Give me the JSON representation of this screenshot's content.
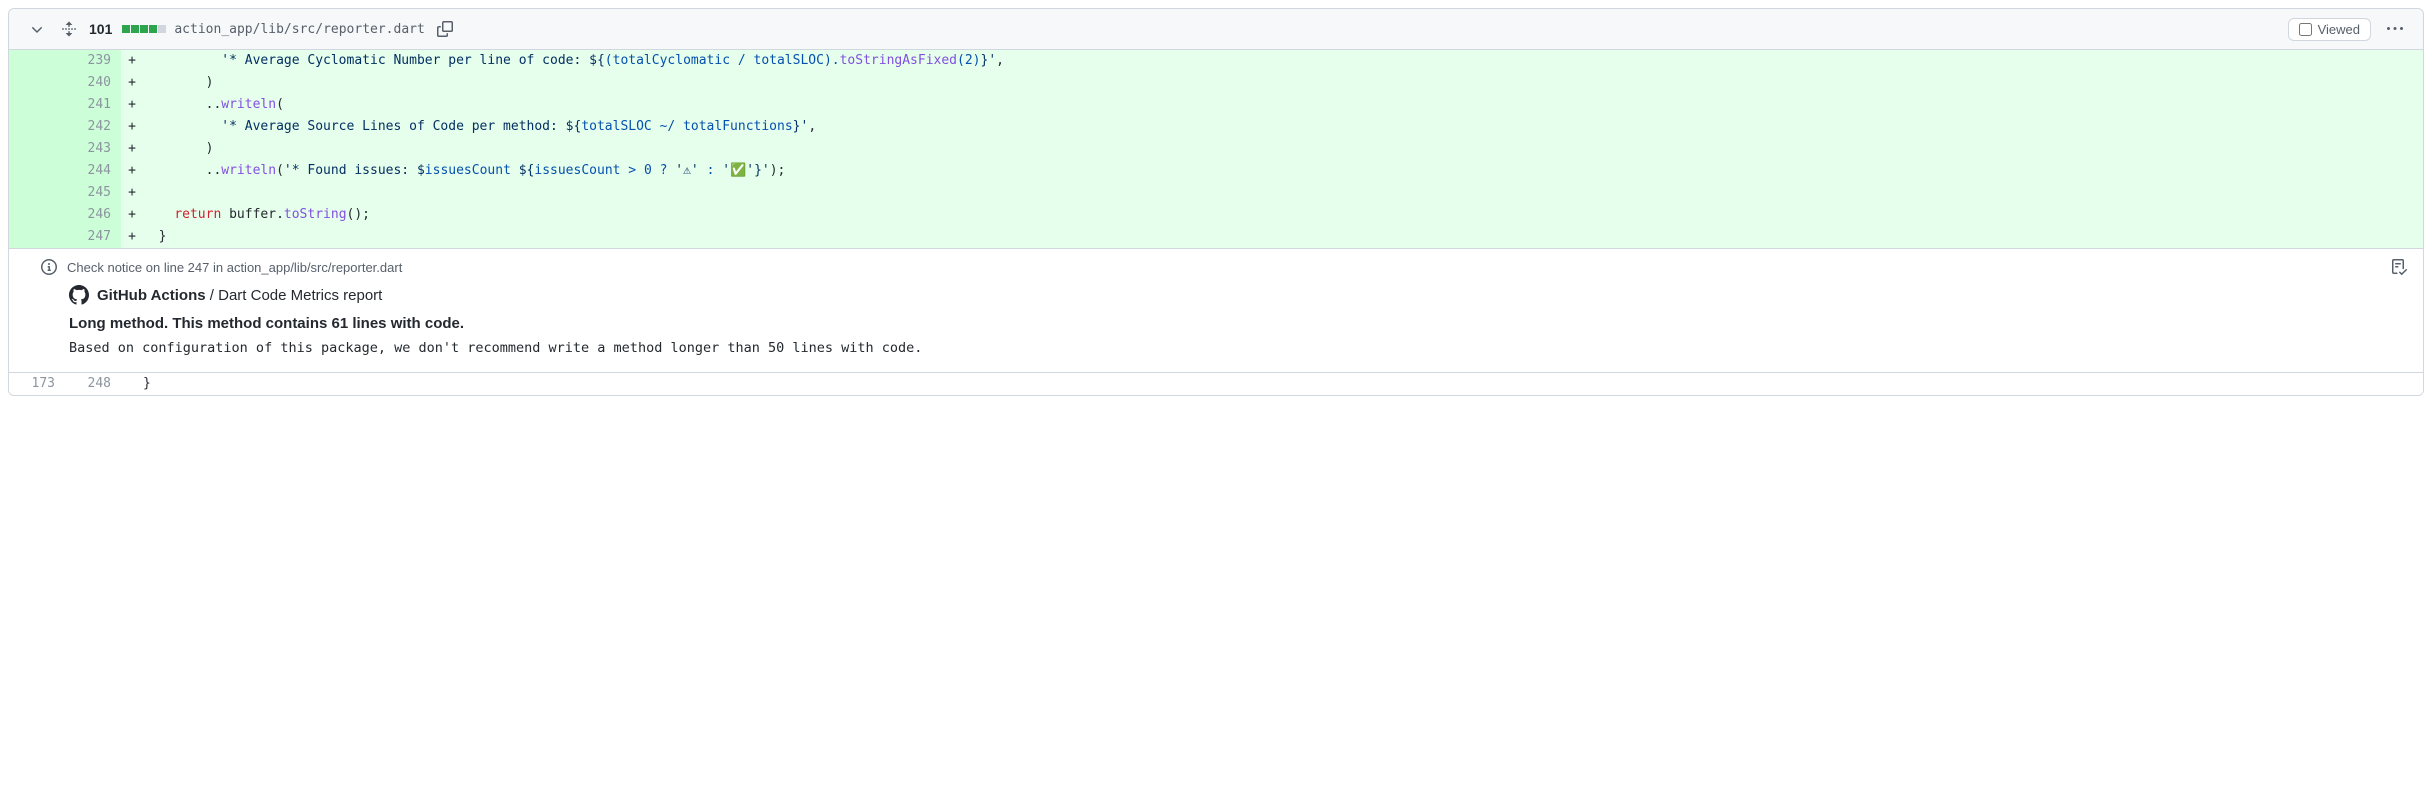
{
  "file": {
    "diff_count": "101",
    "path": "action_app/lib/src/reporter.dart"
  },
  "header": {
    "viewed_label": "Viewed"
  },
  "lines": [
    {
      "type": "add",
      "old": "",
      "new": "239",
      "marker": "+",
      "pad": "          ",
      "tokens": [
        "s:'* Average Cyclomatic Number per line of code: ",
        "s:$",
        "s:{",
        "v:(totalCyclomatic / totalSLOC).",
        "f:toStringAsFixed",
        "v:(",
        "v:2",
        "v:)",
        "s:}",
        "s:'",
        "p:,"
      ]
    },
    {
      "type": "add",
      "old": "",
      "new": "240",
      "marker": "+",
      "pad": "        ",
      "tokens": [
        "p:)"
      ]
    },
    {
      "type": "add",
      "old": "",
      "new": "241",
      "marker": "+",
      "pad": "        ",
      "tokens": [
        "p:..",
        "f:writeln",
        "p:("
      ]
    },
    {
      "type": "add",
      "old": "",
      "new": "242",
      "marker": "+",
      "pad": "          ",
      "tokens": [
        "s:'* Average Source Lines of Code per method: ",
        "s:$",
        "s:{",
        "v:totalSLOC ",
        "v:~/",
        "v: totalFunctions",
        "s:}",
        "s:'",
        "p:,"
      ]
    },
    {
      "type": "add",
      "old": "",
      "new": "243",
      "marker": "+",
      "pad": "        ",
      "tokens": [
        "p:)"
      ]
    },
    {
      "type": "add",
      "old": "",
      "new": "244",
      "marker": "+",
      "pad": "        ",
      "tokens": [
        "p:..",
        "f:writeln",
        "p:(",
        "s:'* Found issues: ",
        "s:$",
        "v:issuesCount",
        "s: ",
        "s:$",
        "s:{",
        "v:issuesCount ",
        "v:>",
        "v: ",
        "v:0",
        "v: ",
        "v:?",
        "v: ",
        "s:'⚠'",
        "v: ",
        "v::",
        "v: ",
        "s:'✅'",
        "s:}",
        "s:'",
        "p:);"
      ]
    },
    {
      "type": "add",
      "old": "",
      "new": "245",
      "marker": "+",
      "pad": "",
      "tokens": []
    },
    {
      "type": "add",
      "old": "",
      "new": "246",
      "marker": "+",
      "pad": "    ",
      "tokens": [
        "k:return",
        "p: buffer.",
        "f:toString",
        "p:();"
      ]
    },
    {
      "type": "add",
      "old": "",
      "new": "247",
      "marker": "+",
      "pad": "  ",
      "tokens": [
        "p:}"
      ]
    }
  ],
  "annotation": {
    "location": "Check notice on line 247 in action_app/lib/src/reporter.dart",
    "source_name": "GitHub Actions",
    "source_sep": " / ",
    "source_detail": "Dart Code Metrics report",
    "title": "Long method. This method contains 61 lines with code.",
    "description": "Based on configuration of this package, we don't recommend write a method longer than 50 lines with code."
  },
  "post_lines": [
    {
      "type": "ctx",
      "old": "173",
      "new": "248",
      "marker": "",
      "pad": "",
      "tokens": [
        "p:}"
      ]
    }
  ]
}
